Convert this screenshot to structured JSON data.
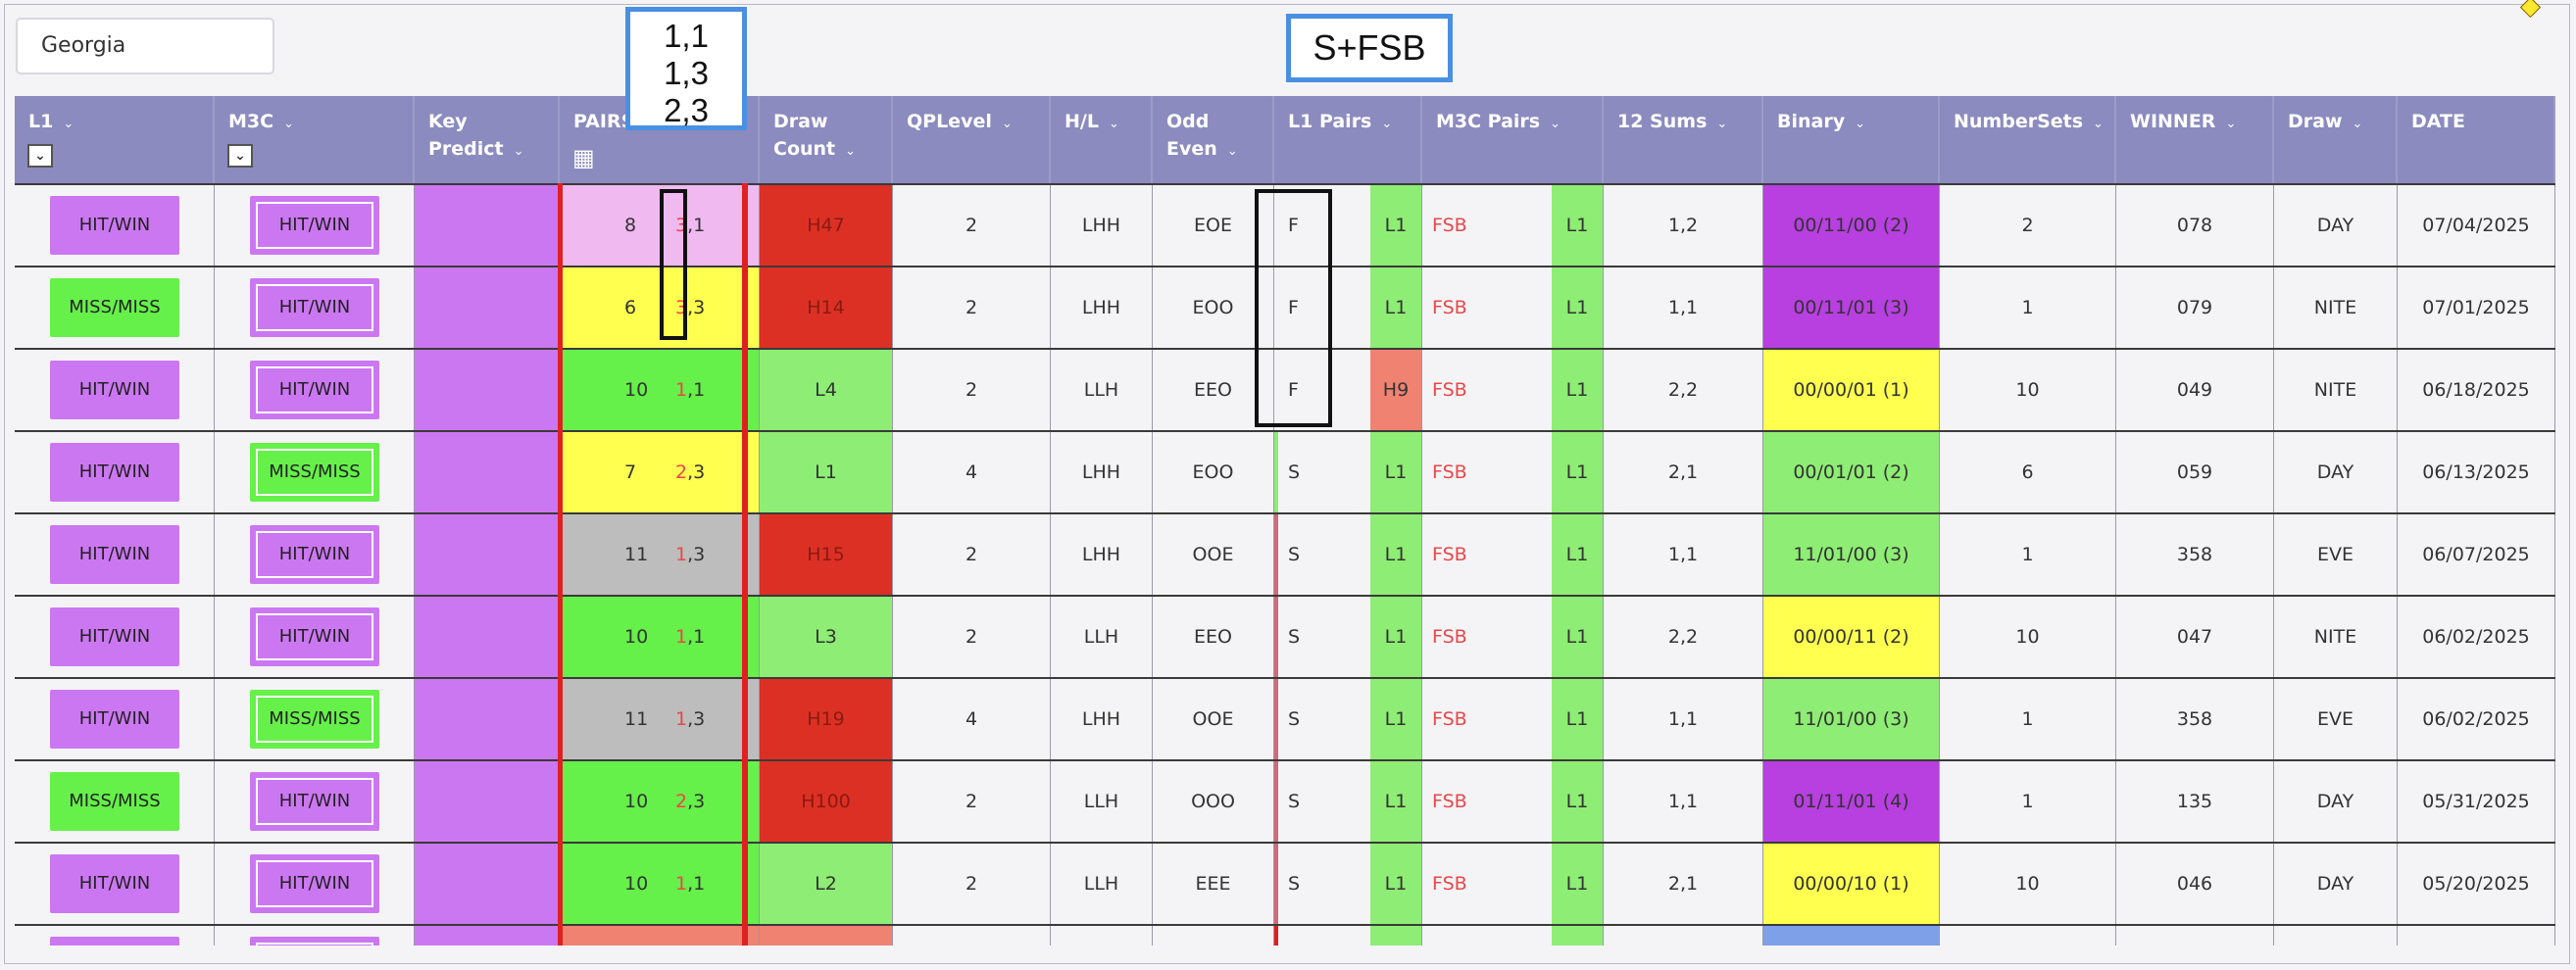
{
  "search": {
    "value": "Georgia"
  },
  "callouts": {
    "pairs_lines": [
      "1,1",
      "1,3",
      "2,3"
    ],
    "sfsb": "S+FSB"
  },
  "headers": [
    {
      "key": "l1",
      "line1": "L1",
      "line2": "",
      "chev": "⌄",
      "extra": "checkbox"
    },
    {
      "key": "m3c",
      "line1": "M3C",
      "line2": "",
      "chev": "⌄",
      "extra": "checkbox"
    },
    {
      "key": "key_predict",
      "line1": "Key",
      "line2": "Predict",
      "chev": "⌄",
      "extra": ""
    },
    {
      "key": "pairs",
      "line1": "PAIRS",
      "line2": "",
      "chev": "",
      "extra": "calendar"
    },
    {
      "key": "draw_count",
      "line1": "Draw",
      "line2": "Count",
      "chev": "⌄",
      "extra": ""
    },
    {
      "key": "qplevel",
      "line1": "QPLevel",
      "line2": "",
      "chev": "⌄",
      "extra": ""
    },
    {
      "key": "hl",
      "line1": "H/L",
      "line2": "",
      "chev": "⌄",
      "extra": ""
    },
    {
      "key": "odd_even",
      "line1": "Odd",
      "line2": "Even",
      "chev": "⌄",
      "extra": ""
    },
    {
      "key": "l1_pairs",
      "line1": "L1 Pairs",
      "line2": "",
      "chev": "⌄",
      "extra": ""
    },
    {
      "key": "m3c_pairs",
      "line1": "M3C Pairs",
      "line2": "",
      "chev": "⌄",
      "extra": ""
    },
    {
      "key": "sums",
      "line1": "12 Sums",
      "line2": "",
      "chev": "⌄",
      "extra": ""
    },
    {
      "key": "binary",
      "line1": "Binary",
      "line2": "",
      "chev": "⌄",
      "extra": ""
    },
    {
      "key": "numbersets",
      "line1": "NumberSets",
      "line2": "",
      "chev": "⌄",
      "extra": ""
    },
    {
      "key": "winner",
      "line1": "WINNER",
      "line2": "",
      "chev": "⌄",
      "extra": ""
    },
    {
      "key": "draw",
      "line1": "Draw",
      "line2": "",
      "chev": "⌄",
      "extra": ""
    },
    {
      "key": "date",
      "line1": "DATE",
      "line2": "",
      "chev": "",
      "extra": ""
    }
  ],
  "colors": {
    "purple": "#cc77f2",
    "green": "#66f04a",
    "yellow": "#ffff50",
    "gray": "#bdbdbd",
    "pink": "#f0b9f0",
    "red": "#dd3024",
    "lightgreen": "#8eed74",
    "salmon": "#f08272",
    "binpurple": "#b83fe0",
    "blue": "#7ea0e8",
    "white": "#f4f4f7",
    "header": "#8b8bbf"
  },
  "rows": [
    {
      "l1": "HIT/WIN",
      "l1c": "purple",
      "m3c": "HIT/WIN",
      "m3cc": "purple",
      "pairs_c": "pink",
      "pairs_n": "8",
      "pair_a": "3",
      "pair_b": "1",
      "dc": "H47",
      "dcc": "red",
      "qp": "2",
      "hl": "LHH",
      "oe": "EOE",
      "l1p": "F",
      "l1p2": "L1",
      "l1p2c": "lightgreen",
      "m3p": "FSB",
      "m3p2": "L1",
      "sums": "1,2",
      "bin": "00/11/00 (2)",
      "binc": "binpurple",
      "ns": "2",
      "winner": "078",
      "draw": "DAY",
      "date": "07/04/2025"
    },
    {
      "l1": "MISS/MISS",
      "l1c": "green",
      "m3c": "HIT/WIN",
      "m3cc": "purple",
      "pairs_c": "yellow",
      "pairs_n": "6",
      "pair_a": "3",
      "pair_b": "3",
      "dc": "H14",
      "dcc": "red",
      "qp": "2",
      "hl": "LHH",
      "oe": "EOO",
      "l1p": "F",
      "l1p2": "L1",
      "l1p2c": "lightgreen",
      "m3p": "FSB",
      "m3p2": "L1",
      "sums": "1,1",
      "bin": "00/11/01 (3)",
      "binc": "binpurple",
      "ns": "1",
      "winner": "079",
      "draw": "NITE",
      "date": "07/01/2025"
    },
    {
      "l1": "HIT/WIN",
      "l1c": "purple",
      "m3c": "HIT/WIN",
      "m3cc": "purple",
      "pairs_c": "green",
      "pairs_n": "10",
      "pair_a": "1",
      "pair_b": "1",
      "dc": "L4",
      "dcc": "lightgreen",
      "qp": "2",
      "hl": "LLH",
      "oe": "EEO",
      "l1p": "F",
      "l1p2": "H9",
      "l1p2c": "salmon",
      "m3p": "FSB",
      "m3p2": "L1",
      "sums": "2,2",
      "bin": "00/00/01 (1)",
      "binc": "yellow",
      "ns": "10",
      "winner": "049",
      "draw": "NITE",
      "date": "06/18/2025"
    },
    {
      "l1": "HIT/WIN",
      "l1c": "purple",
      "m3c": "MISS/MISS",
      "m3cc": "green",
      "pairs_c": "yellow",
      "pairs_n": "7",
      "pair_a": "2",
      "pair_b": "3",
      "dc": "L1",
      "dcc": "lightgreen",
      "qp": "4",
      "hl": "LHH",
      "oe": "EOO",
      "l1p": "S",
      "l1p2": "L1",
      "l1p2c": "lightgreen",
      "m3p": "FSB",
      "m3p2": "L1",
      "sums": "2,1",
      "bin": "00/01/01 (2)",
      "binc": "lightgreen",
      "ns": "6",
      "winner": "059",
      "draw": "DAY",
      "date": "06/13/2025"
    },
    {
      "l1": "HIT/WIN",
      "l1c": "purple",
      "m3c": "HIT/WIN",
      "m3cc": "purple",
      "pairs_c": "gray",
      "pairs_n": "11",
      "pair_a": "1",
      "pair_b": "3",
      "dc": "H15",
      "dcc": "red",
      "qp": "2",
      "hl": "LHH",
      "oe": "OOE",
      "l1p": "S",
      "l1p2": "L1",
      "l1p2c": "lightgreen",
      "m3p": "FSB",
      "m3p2": "L1",
      "sums": "1,1",
      "bin": "11/01/00 (3)",
      "binc": "lightgreen",
      "ns": "1",
      "winner": "358",
      "draw": "EVE",
      "date": "06/07/2025"
    },
    {
      "l1": "HIT/WIN",
      "l1c": "purple",
      "m3c": "HIT/WIN",
      "m3cc": "purple",
      "pairs_c": "green",
      "pairs_n": "10",
      "pair_a": "1",
      "pair_b": "1",
      "dc": "L3",
      "dcc": "lightgreen",
      "qp": "2",
      "hl": "LLH",
      "oe": "EEO",
      "l1p": "S",
      "l1p2": "L1",
      "l1p2c": "lightgreen",
      "m3p": "FSB",
      "m3p2": "L1",
      "sums": "2,2",
      "bin": "00/00/11 (2)",
      "binc": "yellow",
      "ns": "10",
      "winner": "047",
      "draw": "NITE",
      "date": "06/02/2025"
    },
    {
      "l1": "HIT/WIN",
      "l1c": "purple",
      "m3c": "MISS/MISS",
      "m3cc": "green",
      "pairs_c": "gray",
      "pairs_n": "11",
      "pair_a": "1",
      "pair_b": "3",
      "dc": "H19",
      "dcc": "red",
      "qp": "4",
      "hl": "LHH",
      "oe": "OOE",
      "l1p": "S",
      "l1p2": "L1",
      "l1p2c": "lightgreen",
      "m3p": "FSB",
      "m3p2": "L1",
      "sums": "1,1",
      "bin": "11/01/00 (3)",
      "binc": "lightgreen",
      "ns": "1",
      "winner": "358",
      "draw": "EVE",
      "date": "06/02/2025"
    },
    {
      "l1": "MISS/MISS",
      "l1c": "green",
      "m3c": "HIT/WIN",
      "m3cc": "purple",
      "pairs_c": "green",
      "pairs_n": "10",
      "pair_a": "2",
      "pair_b": "3",
      "dc": "H100",
      "dcc": "red",
      "qp": "2",
      "hl": "LLH",
      "oe": "OOO",
      "l1p": "S",
      "l1p2": "L1",
      "l1p2c": "lightgreen",
      "m3p": "FSB",
      "m3p2": "L1",
      "sums": "1,1",
      "bin": "01/11/01 (4)",
      "binc": "binpurple",
      "ns": "1",
      "winner": "135",
      "draw": "DAY",
      "date": "05/31/2025"
    },
    {
      "l1": "HIT/WIN",
      "l1c": "purple",
      "m3c": "HIT/WIN",
      "m3cc": "purple",
      "pairs_c": "green",
      "pairs_n": "10",
      "pair_a": "1",
      "pair_b": "1",
      "dc": "L2",
      "dcc": "lightgreen",
      "qp": "2",
      "hl": "LLH",
      "oe": "EEE",
      "l1p": "S",
      "l1p2": "L1",
      "l1p2c": "lightgreen",
      "m3p": "FSB",
      "m3p2": "L1",
      "sums": "2,1",
      "bin": "00/00/10 (1)",
      "binc": "yellow",
      "ns": "10",
      "winner": "046",
      "draw": "DAY",
      "date": "05/20/2025"
    },
    {
      "l1": "",
      "l1c": "purple",
      "m3c": "",
      "m3cc": "purple",
      "pairs_c": "salmon",
      "pairs_n": "",
      "pair_a": "",
      "pair_b": "",
      "dc": "",
      "dcc": "salmon",
      "qp": "",
      "hl": "",
      "oe": "",
      "l1p": "",
      "l1p2": "",
      "l1p2c": "lightgreen",
      "m3p": "",
      "m3p2": "",
      "sums": "",
      "bin": "",
      "binc": "blue",
      "ns": "",
      "winner": "",
      "draw": "",
      "date": ""
    }
  ]
}
